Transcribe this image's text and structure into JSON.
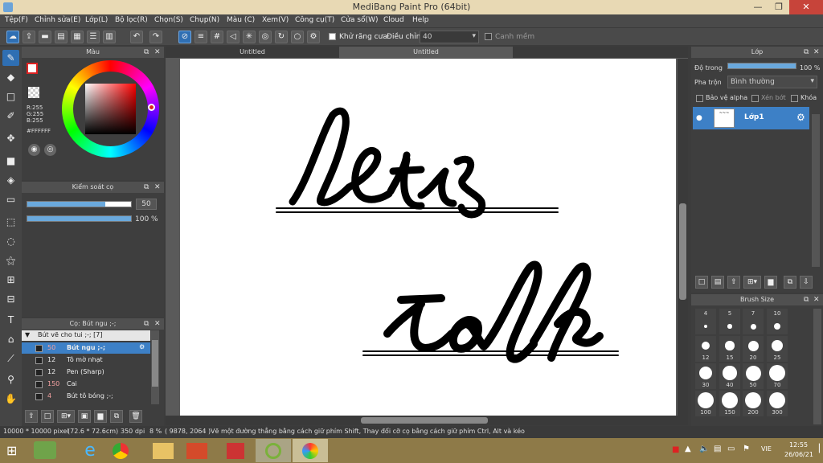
{
  "app": {
    "title": "MediBang Paint Pro (64bit)",
    "window_controls": {
      "minimize": "—",
      "maximize": "❐",
      "close": "✕"
    }
  },
  "menu": [
    "Tệp(F)",
    "Chỉnh sửa(E)",
    "Lớp(L)",
    "Bộ lọc(R)",
    "Chọn(S)",
    "Chụp(N)",
    "Màu (C)",
    "Xem(V)",
    "Công cụ(T)",
    "Cửa sổ(W)",
    "Cloud",
    "Help"
  ],
  "toolbar": {
    "antialias_label": "Khử răng cưa",
    "adjust_label": "Điều chỉnh",
    "adjust_value": "40",
    "edge_label": "Canh mềm"
  },
  "tabs": [
    "Untitled",
    "Untitled"
  ],
  "color_panel": {
    "title": "Màu",
    "r": "R:255",
    "g": "G:255",
    "b": "B:255",
    "hex": "#FFFFFF"
  },
  "brush_control": {
    "title": "Kiểm soát cọ",
    "size": "50",
    "size_fill": 0.75,
    "opacity": "100 %",
    "opacity_fill": 1.0
  },
  "brush_list": {
    "title": "Cọ: Bút ngu ;-;",
    "group": "Bút vẽ cho tui ;-; [7]",
    "items": [
      {
        "size": "50",
        "name": "Bút ngu ;-;"
      },
      {
        "size": "12",
        "name": "Tô mờ nhạt"
      },
      {
        "size": "12",
        "name": "Pen (Sharp)"
      },
      {
        "size": "150",
        "name": "Cai"
      },
      {
        "size": "4",
        "name": "Bút tô bóng ;-;"
      }
    ]
  },
  "layer_panel": {
    "title": "Lớp",
    "opacity_label": "Độ trong",
    "opacity_value": "100 %",
    "blend_label": "Pha trộn",
    "blend_value": "Bình thường",
    "protect_alpha": "Bảo vệ alpha",
    "clipping": "Xén bớt",
    "lock": "Khóa",
    "layer_name": "Lớp1"
  },
  "brush_size_panel": {
    "title": "Brush Size",
    "sizes": [
      "4",
      "5",
      "7",
      "10",
      "12",
      "15",
      "20",
      "25",
      "30",
      "40",
      "50",
      "70",
      "100",
      "150",
      "200",
      "300"
    ]
  },
  "status": {
    "dimensions": "10000 * 10000 pixel",
    "physical": "(72.6 * 72.6cm)",
    "dpi": "350 dpi",
    "zoom": "8 %",
    "coords": "( 9878, 2064 )",
    "hint": "Vẽ một đường thẳng bằng cách giữ phím Shift, Thay đổi cỡ cọ bằng cách giữ phím Ctrl, Alt và kéo"
  },
  "taskbar": {
    "lang": "VIE",
    "time": "12:55",
    "date": "26/06/21"
  },
  "colors": {
    "accent": "#2f6fb3",
    "selected_row": "#3d80c6",
    "slider_fill": "#6aa9dd"
  }
}
